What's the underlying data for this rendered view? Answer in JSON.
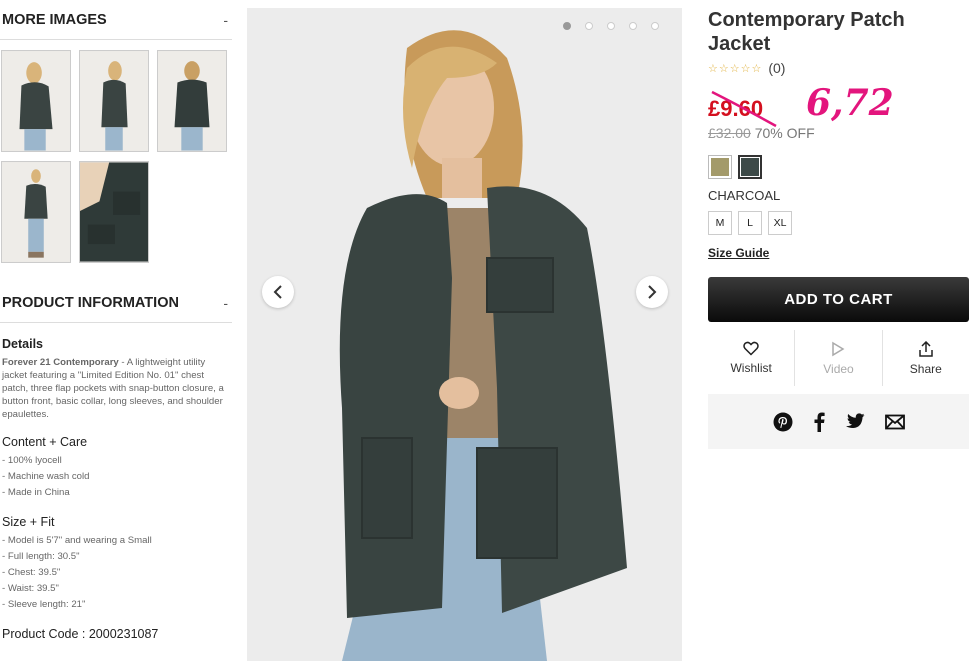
{
  "more_images": {
    "heading": "MORE IMAGES",
    "toggle": "-"
  },
  "product_info": {
    "heading": "PRODUCT INFORMATION",
    "toggle": "-",
    "details_heading": "Details",
    "brand": "Forever 21 Contemporary",
    "description": " - A lightweight utility jacket featuring a \"Limited Edition No. 01\" chest patch, three flap pockets with snap-button closure, a button front, basic collar, long sleeves, and shoulder epaulettes.",
    "content_heading": "Content + Care",
    "content_items": [
      "- 100% lyocell",
      "- Machine wash cold",
      "- Made in China"
    ],
    "size_heading": "Size + Fit",
    "size_items": [
      "- Model is 5'7\" and wearing a Small",
      "- Full length: 30.5\"",
      "- Chest: 39.5\"",
      "- Waist: 39.5\"",
      "- Sleeve length: 21\""
    ],
    "product_code": "Product Code : 2000231087"
  },
  "product": {
    "title": "Contemporary Patch Jacket",
    "stars": "☆☆☆☆☆",
    "review_count": "(0)",
    "sale_price": "£9.60",
    "handwritten_price": "6,72",
    "original_price": "£32.00",
    "discount": "70% OFF",
    "selected_color": "CHARCOAL",
    "sizes": [
      "M",
      "L",
      "XL"
    ],
    "size_guide": "Size Guide",
    "add_to_cart": "ADD TO CART"
  },
  "actions": {
    "wishlist": "Wishlist",
    "video": "Video",
    "share": "Share"
  },
  "colors": {
    "sale_red": "#d4101f",
    "annotation_pink": "#e3157d",
    "swatch_olive": "#a39a6a",
    "swatch_charcoal": "#3d4a48"
  }
}
